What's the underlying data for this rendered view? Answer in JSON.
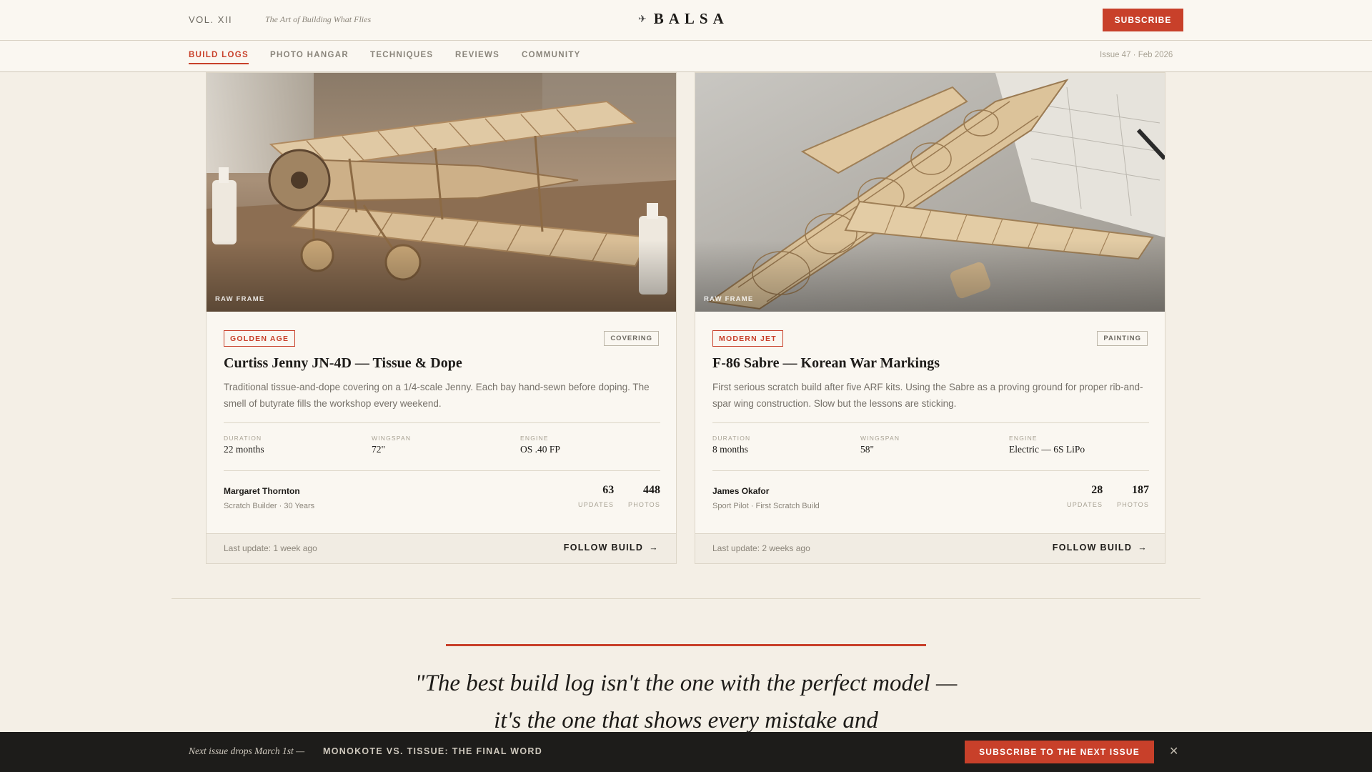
{
  "header": {
    "volume": "VOL. XII",
    "tagline": "The Art of Building What Flies",
    "logo_text": "BALSA",
    "logo_icon": "plane-icon",
    "subscribe_label": "SUBSCRIBE",
    "issue_info": "Issue 47 · Feb 2026"
  },
  "nav": {
    "items": [
      {
        "label": "BUILD LOGS",
        "active": true
      },
      {
        "label": "PHOTO HANGAR",
        "active": false
      },
      {
        "label": "TECHNIQUES",
        "active": false
      },
      {
        "label": "REVIEWS",
        "active": false
      },
      {
        "label": "COMMUNITY",
        "active": false
      }
    ]
  },
  "cards": [
    {
      "photo_label": "RAW FRAME",
      "category": "GOLDEN AGE",
      "stage": "COVERING",
      "title": "Curtiss Jenny JN-4D — Tissue & Dope",
      "description": "Traditional tissue-and-dope covering on a 1/4-scale Jenny. Each bay hand-sewn before doping. The smell of butyrate fills the workshop every weekend.",
      "specs": [
        {
          "label": "DURATION",
          "value": "22 months"
        },
        {
          "label": "WINGSPAN",
          "value": "72\""
        },
        {
          "label": "ENGINE",
          "value": "OS .40 FP"
        }
      ],
      "author": "Margaret Thornton",
      "author_meta": "Scratch Builder · 30 Years",
      "stats": [
        {
          "value": "63",
          "label": "UPDATES"
        },
        {
          "value": "448",
          "label": "PHOTOS"
        }
      ],
      "last_update": "Last update: 1 week ago",
      "follow_label": "FOLLOW BUILD"
    },
    {
      "photo_label": "RAW FRAME",
      "category": "MODERN JET",
      "stage": "PAINTING",
      "title": "F-86 Sabre — Korean War Markings",
      "description": "First serious scratch build after five ARF kits. Using the Sabre as a proving ground for proper rib-and-spar wing construction. Slow but the lessons are sticking.",
      "specs": [
        {
          "label": "DURATION",
          "value": "8 months"
        },
        {
          "label": "WINGSPAN",
          "value": "58\""
        },
        {
          "label": "ENGINE",
          "value": "Electric — 6S LiPo"
        }
      ],
      "author": "James Okafor",
      "author_meta": "Sport Pilot · First Scratch Build",
      "stats": [
        {
          "value": "28",
          "label": "UPDATES"
        },
        {
          "value": "187",
          "label": "PHOTOS"
        }
      ],
      "last_update": "Last update: 2 weeks ago",
      "follow_label": "FOLLOW BUILD"
    }
  ],
  "quote": {
    "text": "\"The best build log isn't the one with the perfect model — it's the one that shows every mistake and"
  },
  "banner": {
    "lead": "Next issue drops March 1st —",
    "headline": "MONOKOTE VS. TISSUE: THE FINAL WORD",
    "cta_label": "SUBSCRIBE TO THE NEXT ISSUE",
    "close_icon": "close-icon"
  },
  "colors": {
    "accent": "#c8402a",
    "background": "#f4efe6",
    "card": "#faf7f1",
    "banner": "#1d1c1a"
  }
}
